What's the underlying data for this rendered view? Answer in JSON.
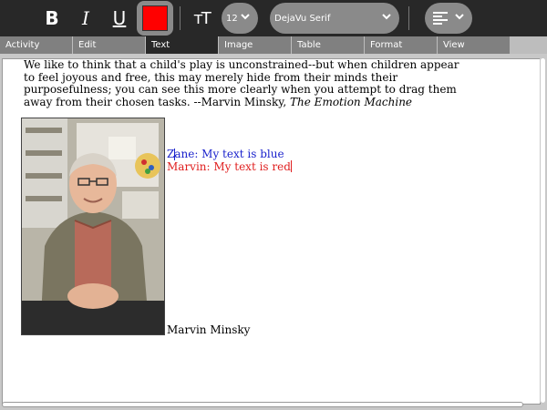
{
  "toolbar": {
    "bold_label": "B",
    "italic_label": "I",
    "underline_label": "U",
    "text_color": "#ff0000",
    "size_icon_label": "ᴛT",
    "font_size": "12",
    "font_name": "DejaVu Serif",
    "icons": [
      "bold-icon",
      "italic-icon",
      "underline-icon",
      "color-swatch",
      "text-size-icon",
      "chevron-down-icon",
      "align-left-icon"
    ]
  },
  "tabs": [
    {
      "label": "Activity"
    },
    {
      "label": "Edit"
    },
    {
      "label": "Text",
      "active": true
    },
    {
      "label": "Image"
    },
    {
      "label": "Table"
    },
    {
      "label": "Format"
    },
    {
      "label": "View"
    }
  ],
  "document": {
    "quote": "We like to think that a child's play is unconstrained--but when children appear to feel joyous and free, this may merely hide from their minds their purposefulness; you can see this more clearly when you attempt to drag them away from their chosen tasks. --Marvin Minsky, ",
    "quote_source": "The Emotion Machine",
    "line_blue": "Zane: My text is blue",
    "line_red": "Marvin: My text is red",
    "caption": "Marvin Minsky",
    "colors": {
      "blue": "#1a22cc",
      "red": "#e02020"
    }
  }
}
